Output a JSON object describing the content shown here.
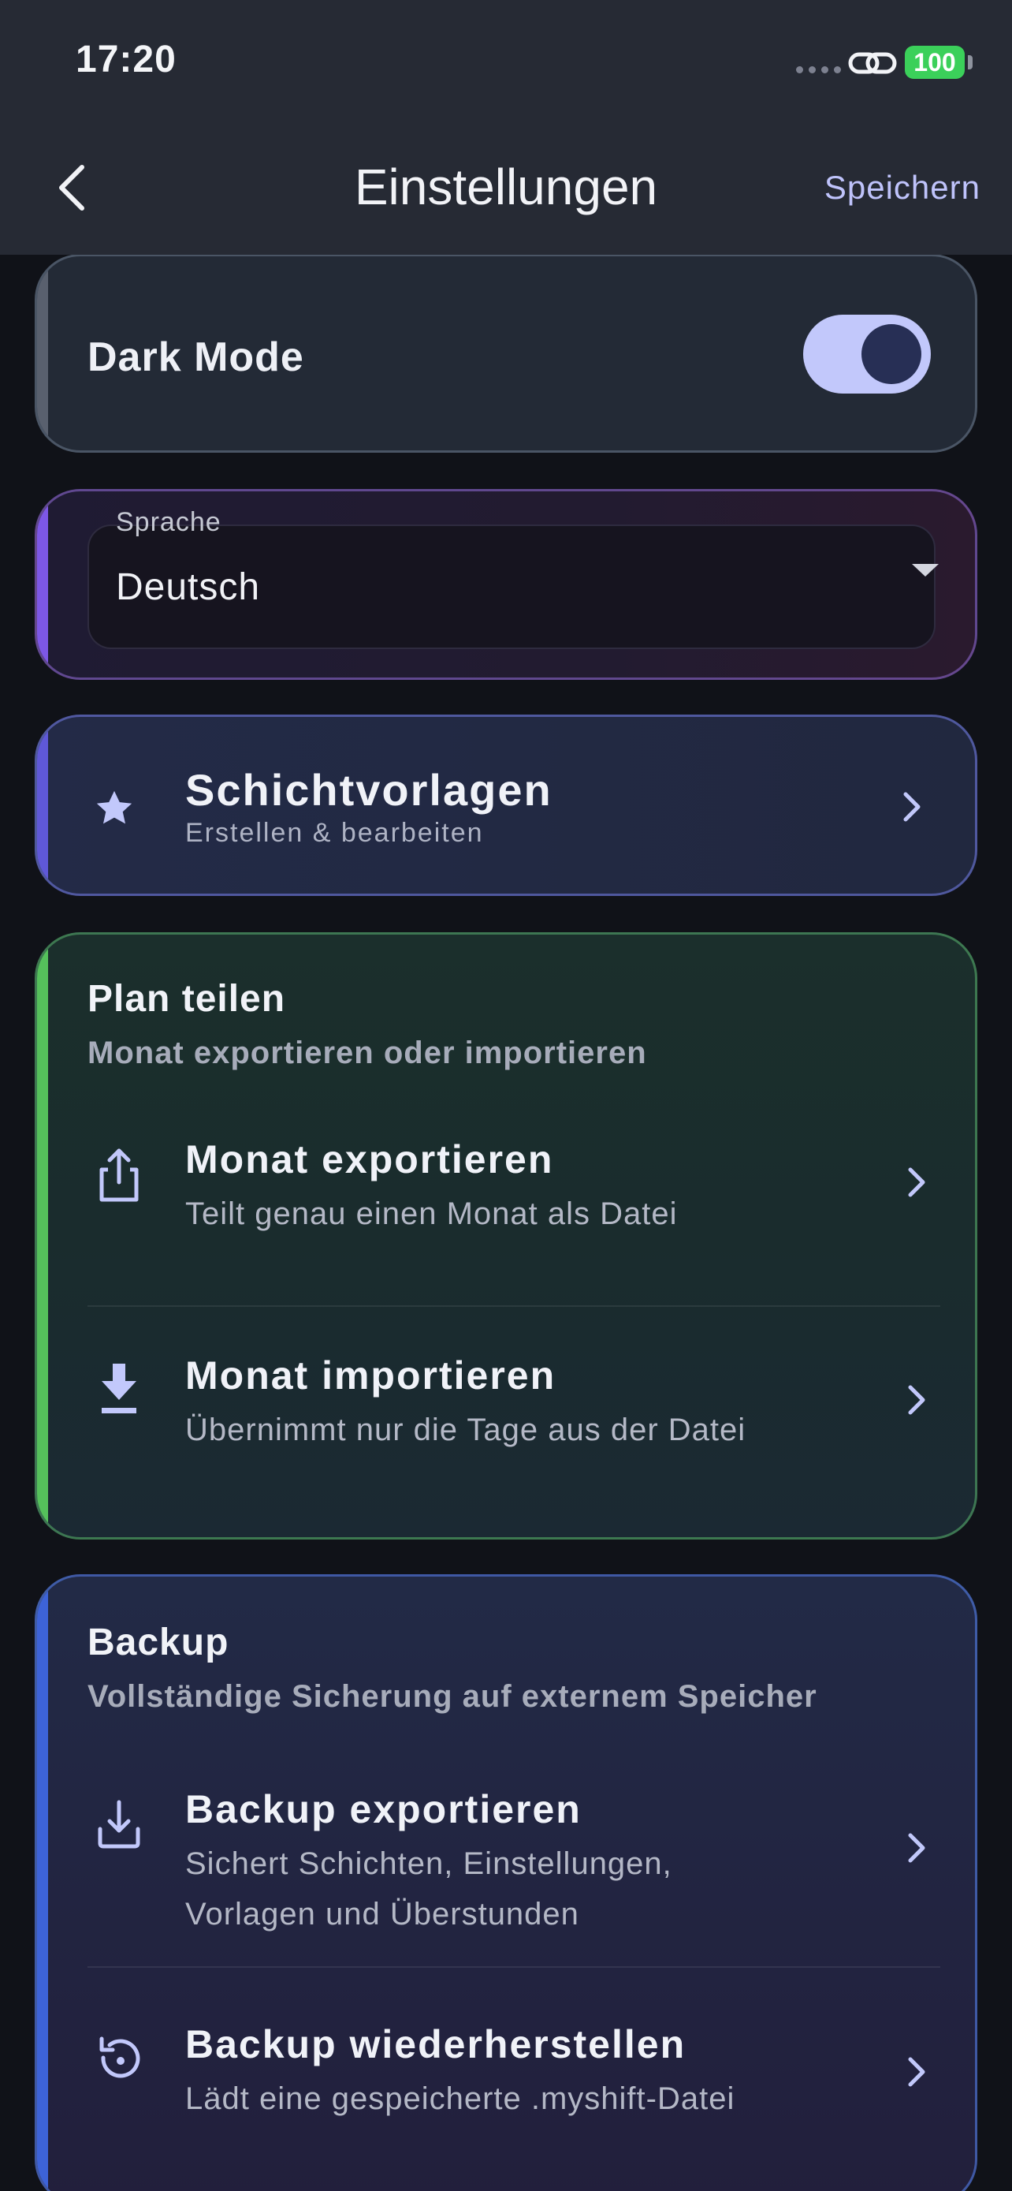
{
  "status_bar": {
    "time": "17:20",
    "battery": "100"
  },
  "nav": {
    "title": "Einstellungen",
    "save_label": "Speichern"
  },
  "dark_mode": {
    "label": "Dark Mode",
    "enabled": true
  },
  "language": {
    "caption": "Sprache",
    "value": "Deutsch"
  },
  "templates": {
    "title": "Schichtvorlagen",
    "subtitle": "Erstellen & bearbeiten"
  },
  "share": {
    "title": "Plan teilen",
    "subtitle": "Monat exportieren oder importieren",
    "items": [
      {
        "title": "Monat exportieren",
        "subtitle": "Teilt genau einen Monat als Datei"
      },
      {
        "title": "Monat importieren",
        "subtitle": "Übernimmt nur die Tage aus der Datei"
      }
    ]
  },
  "backup": {
    "title": "Backup",
    "subtitle": "Vollständige Sicherung auf externem Speicher",
    "items": [
      {
        "title": "Backup exportieren",
        "subtitle_line1": "Sichert Schichten, Einstellungen,",
        "subtitle_line2": "Vorlagen und Überstunden"
      },
      {
        "title": "Backup wiederherstellen",
        "subtitle": "Lädt eine gespeicherte .myshift-Datei"
      }
    ]
  },
  "colors": {
    "accent_lavender": "#c2c8fb",
    "share_green": "#55c05b",
    "backup_blue": "#3d63d8",
    "language_purple": "#7d57e6",
    "battery_green": "#3bd05a"
  },
  "icons": [
    "chevron-left-icon",
    "star-icon",
    "share-icon",
    "download-icon",
    "backup-export-icon",
    "restore-icon",
    "chevron-right-icon",
    "link-icon"
  ]
}
